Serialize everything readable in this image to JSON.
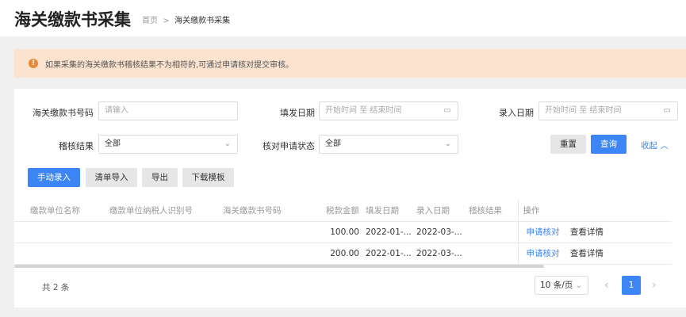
{
  "header": {
    "title": "海关缴款书采集",
    "breadcrumb_home": "首页",
    "breadcrumb_sep": ">",
    "breadcrumb_current": "海关缴款书采集"
  },
  "alert": {
    "icon": "exclamation-icon",
    "text": "如果采集的海关缴款书稽核结果不为相符的,可通过申请核对提交审核。"
  },
  "filters": {
    "no_label": "海关缴款书号码",
    "no_placeholder": "请输入",
    "issue_label": "填发日期",
    "issue_start": "开始时间",
    "issue_sep": "至",
    "issue_end": "结束时间",
    "entry_label": "录入日期",
    "entry_start": "开始时间",
    "entry_sep": "至",
    "entry_end": "结束时间",
    "audit_label": "稽核结果",
    "audit_value": "全部",
    "apply_label": "核对申请状态",
    "apply_value": "全部",
    "reset": "重置",
    "search": "查询",
    "collapse": "收起"
  },
  "actions": {
    "manual": "手动录入",
    "import": "清单导入",
    "export": "导出",
    "template": "下载模板"
  },
  "table": {
    "headers": [
      "缴款单位名称",
      "缴款单位纳税人识别号",
      "海关缴款书号码",
      "税款金额",
      "填发日期",
      "录入日期",
      "稽核结果",
      "操作"
    ],
    "rows": [
      {
        "amount": "100.00",
        "issue": "2022-01-...",
        "entry": "2022-03-...",
        "result": "",
        "op1": "申请核对",
        "op2": "查看详情"
      },
      {
        "amount": "200.00",
        "issue": "2022-01-...",
        "entry": "2022-03-...",
        "result": "",
        "op1": "申请核对",
        "op2": "查看详情"
      }
    ]
  },
  "pagination": {
    "total": "共 2 条",
    "page_size": "10 条/页",
    "prev": "‹",
    "current": "1",
    "next": "›"
  }
}
